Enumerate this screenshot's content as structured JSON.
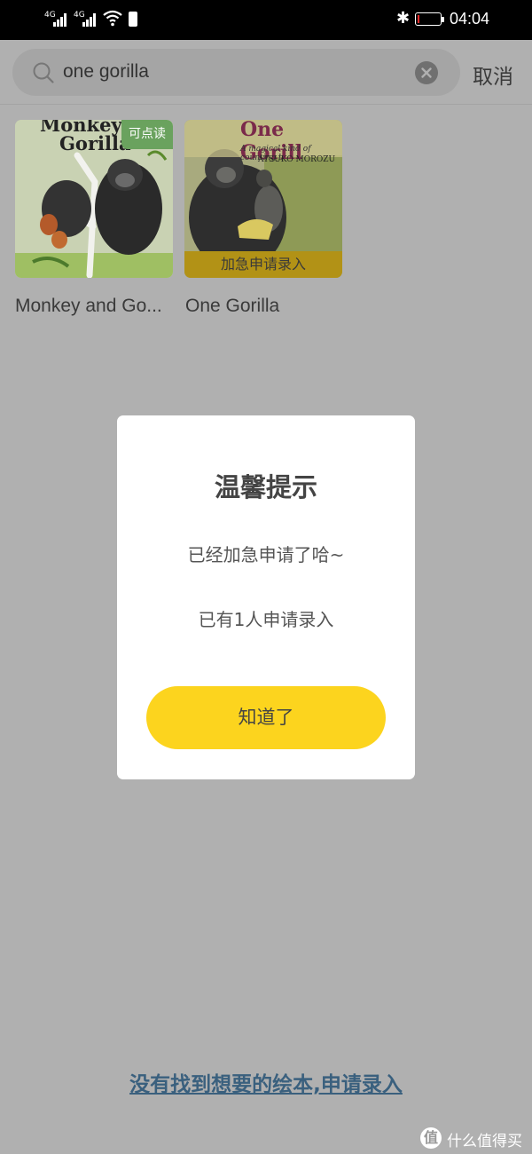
{
  "status_bar": {
    "signal1_label": "4G",
    "signal2_label": "4G",
    "time": "04:04",
    "battery_level": 0.08,
    "battery_color": "#ff2a2a"
  },
  "search": {
    "value": "one gorilla",
    "cancel_label": "取消",
    "icons": {
      "search": "search-icon",
      "clear": "clear-icon"
    }
  },
  "results": [
    {
      "title": "Monkey and Go...",
      "cover_title_line1": "Monkey a",
      "cover_title_line2": "Gorilla",
      "badge": "可点读",
      "badge_color": "#6aa25e"
    },
    {
      "title": "One Gorilla",
      "cover_title": "One Gorill",
      "cover_subtitle": "A magical kind of counting b",
      "cover_author": "ATSUKO MOROZU",
      "action_label": "加急申请录入",
      "action_color": "#b29216"
    }
  ],
  "dialog": {
    "title": "温馨提示",
    "message1": "已经加急申请了哈~",
    "message2": "已有1人申请录入",
    "confirm_label": "知道了",
    "confirm_color": "#fcd41e"
  },
  "footer": {
    "request_link": "没有找到想要的绘本,申请录入",
    "link_color": "#3a607e"
  },
  "watermark": {
    "logo_char": "值",
    "text": "什么值得买"
  }
}
